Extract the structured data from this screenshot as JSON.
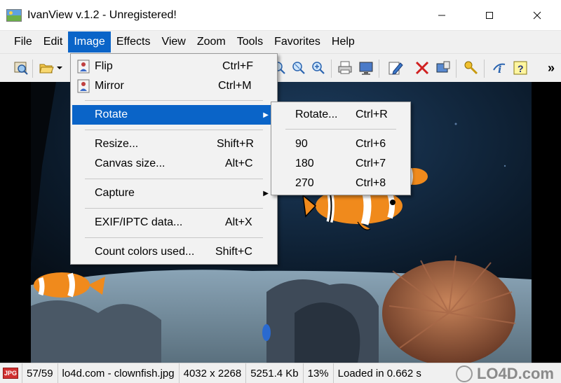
{
  "window": {
    "title": "IvanView v.1.2 - Unregistered!",
    "controls": {
      "minimize": "—",
      "maximize": "☐",
      "close": "✕"
    }
  },
  "menubar": {
    "items": [
      "File",
      "Edit",
      "Image",
      "Effects",
      "View",
      "Zoom",
      "Tools",
      "Favorites",
      "Help"
    ],
    "active": "Image"
  },
  "toolbar": {
    "icons": [
      "open-viewer-icon",
      "folder-open-icon",
      "zoom-in-icon",
      "zoom-fit-icon",
      "zoom-out-icon",
      "print-icon",
      "fullscreen-icon",
      "edit-icon",
      "delete-icon",
      "properties-icon",
      "key-icon",
      "about-icon",
      "help-icon"
    ],
    "overflow": "»"
  },
  "image_menu": {
    "items": [
      {
        "label": "Flip",
        "shortcut": "Ctrl+F",
        "icon": "flip-icon"
      },
      {
        "label": "Mirror",
        "shortcut": "Ctrl+M",
        "icon": "mirror-icon"
      },
      {
        "label": "Rotate",
        "shortcut": "",
        "submenu": true
      },
      {
        "label": "Resize...",
        "shortcut": "Shift+R"
      },
      {
        "label": "Canvas size...",
        "shortcut": "Alt+C"
      },
      {
        "label": "Capture",
        "shortcut": "",
        "submenu": true
      },
      {
        "label": "EXIF/IPTC data...",
        "shortcut": "Alt+X"
      },
      {
        "label": "Count colors used...",
        "shortcut": "Shift+C"
      }
    ]
  },
  "rotate_submenu": {
    "items": [
      {
        "label": "Rotate...",
        "shortcut": "Ctrl+R"
      },
      {
        "label": "90",
        "shortcut": "Ctrl+6"
      },
      {
        "label": "180",
        "shortcut": "Ctrl+7"
      },
      {
        "label": "270",
        "shortcut": "Ctrl+8"
      }
    ]
  },
  "statusbar": {
    "badge": "JPG",
    "position": "57/59",
    "filename": "lo4d.com - clownfish.jpg",
    "dimensions": "4032 x 2268",
    "filesize": "5251.4 Kb",
    "zoom": "13%",
    "load_time": "Loaded in 0.662 s",
    "watermark": "LO4D.com"
  },
  "colors": {
    "accent": "#0a64c8",
    "menu_bg": "#f2f2f2",
    "water": "#0b1a2a",
    "clownfish_orange": "#f08a1c"
  }
}
